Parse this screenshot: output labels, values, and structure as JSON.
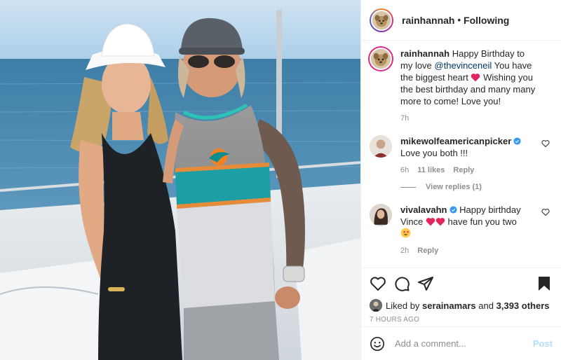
{
  "post": {
    "author": "rainhannah",
    "separator": "•",
    "follow_status": "Following",
    "caption": {
      "username": "rainhannah",
      "text_before": "Happy Birthday to my love",
      "mention": "@thevinceneil",
      "text_middle": "You have the biggest heart",
      "text_after": "Wishing you the best birthday and many many more to come! Love you!",
      "time": "7h"
    },
    "comments": [
      {
        "username": "mikewolfeamericanpicker",
        "verified": true,
        "text": "Love you both !!!",
        "time": "6h",
        "likes": "11 likes",
        "reply_label": "Reply",
        "view_replies": "View replies (1)"
      },
      {
        "username": "vivalavahn",
        "verified": true,
        "text_before": "Happy birthday Vince",
        "text_after": "have fun you two",
        "time": "2h",
        "reply_label": "Reply"
      }
    ],
    "liked_by": {
      "prefix": "Liked by",
      "user": "serainamars",
      "conj": "and",
      "others": "3,393 others"
    },
    "time_ago": "7 HOURS AGO",
    "add_comment": {
      "placeholder": "Add a comment...",
      "post_label": "Post"
    }
  },
  "icons": {
    "like": "heart-outline-icon",
    "comment": "comment-bubble-icon",
    "share": "paper-plane-icon",
    "save": "bookmark-filled-icon",
    "emoji": "smiley-icon",
    "verified": "verified-badge-icon"
  },
  "colors": {
    "link": "#00376b",
    "meta": "#8e8e8e",
    "verified": "#3897f0",
    "post_button_disabled": "#b2dffc",
    "heart_red": "#ed4956"
  }
}
